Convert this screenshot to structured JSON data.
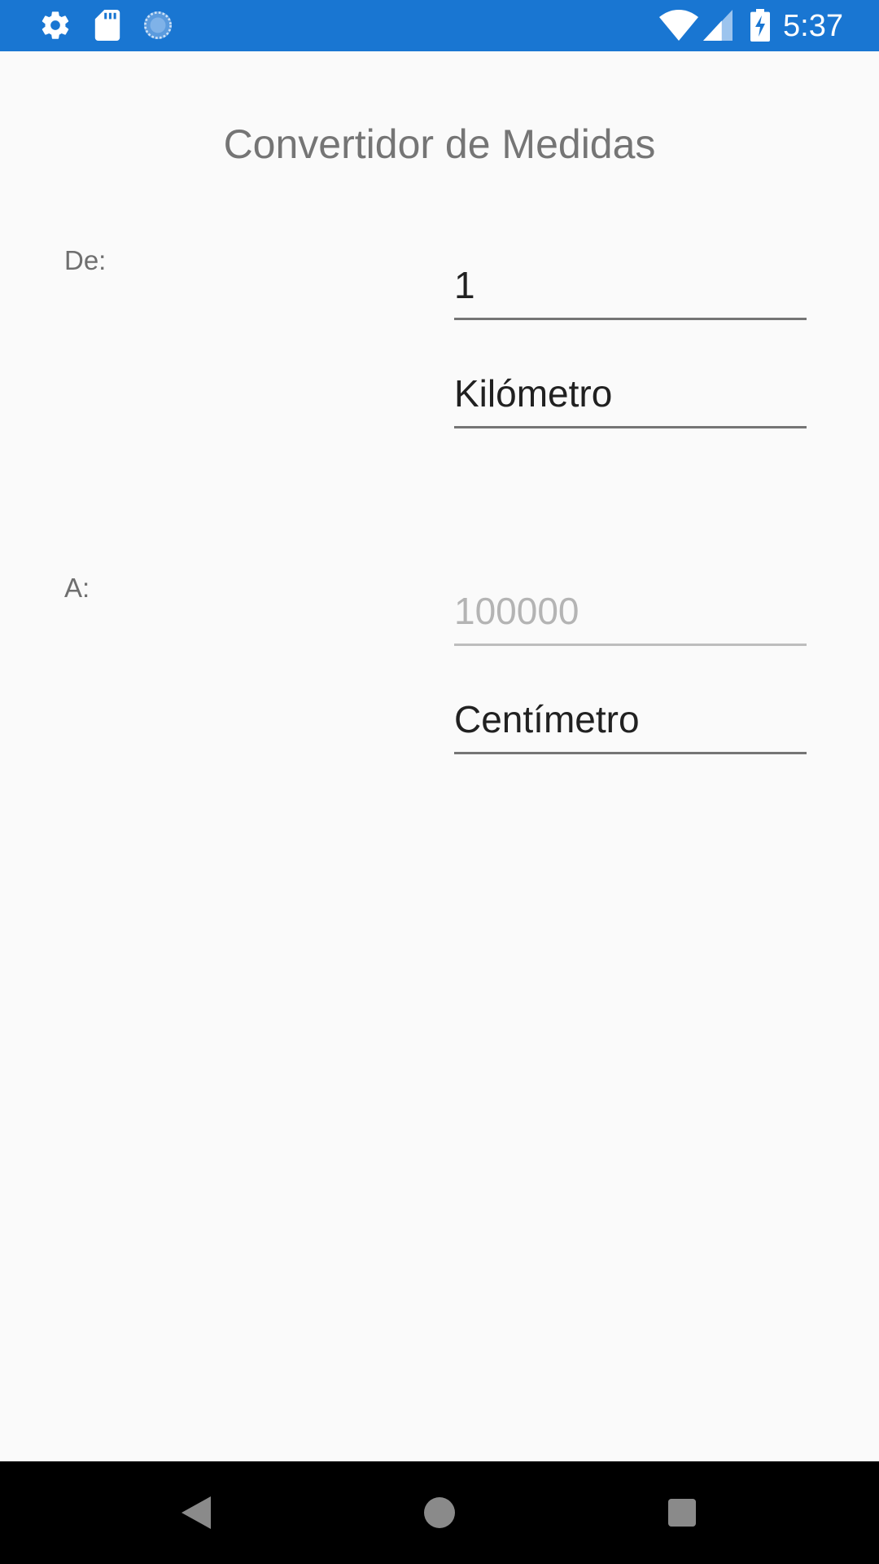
{
  "status_bar": {
    "time": "5:37",
    "background_color": "#1976d2",
    "left_icons": [
      "gear-icon",
      "sd-card-icon",
      "sync-icon"
    ],
    "right_icons": [
      "wifi-icon",
      "cell-signal-icon",
      "battery-charging-icon"
    ]
  },
  "page": {
    "title": "Convertidor de Medidas"
  },
  "from": {
    "label": "De:",
    "value": "1",
    "unit": "Kilómetro"
  },
  "to": {
    "label": "A:",
    "value": "100000",
    "unit": "Centímetro"
  },
  "nav_bar": {
    "buttons": [
      "back-icon",
      "home-icon",
      "recents-icon"
    ]
  }
}
